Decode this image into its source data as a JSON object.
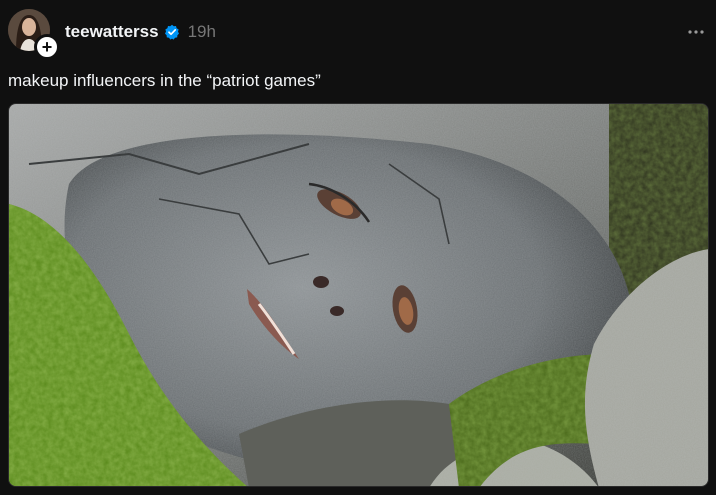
{
  "post": {
    "username": "teewatterss",
    "timestamp": "19h",
    "caption": "makeup influencers in the “patriot games”",
    "more_label": "···",
    "follow_label": "+"
  },
  "icons": {
    "verified": "verified-badge-icon",
    "more": "more-options-icon",
    "follow": "plus-icon"
  },
  "colors": {
    "background": "#101010",
    "text_primary": "#f3f5f7",
    "text_secondary": "#777777",
    "verified": "#0095f6"
  }
}
